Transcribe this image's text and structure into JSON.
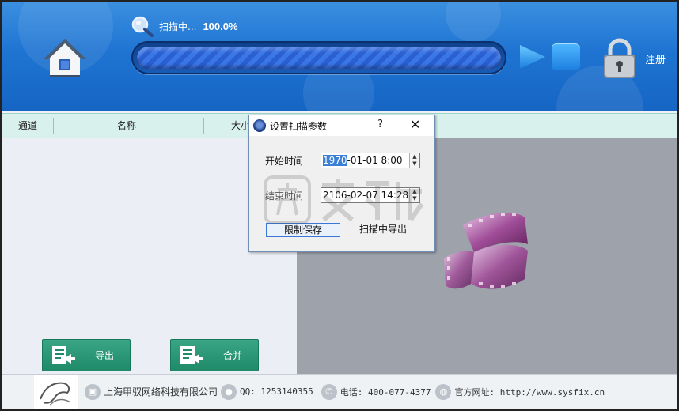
{
  "header": {
    "scan_label": "扫描中...",
    "scan_percent": "100.0%",
    "progress_value": 1.0,
    "register_label": "注册"
  },
  "table": {
    "columns": [
      "通道",
      "名称",
      "大小"
    ]
  },
  "buttons": {
    "export_label": "导出",
    "merge_label": "合并"
  },
  "footer": {
    "company": "上海甲驭网络科技有限公司",
    "qq": "QQ: 1253140355",
    "phone": "电话: 400-077-4377",
    "website": "官方网址: http://www.sysfix.cn"
  },
  "dialog": {
    "title": "设置扫描参数",
    "help": "?",
    "close": "✕",
    "start_label": "开始时间",
    "start_year": "1970",
    "start_rest": "-01-01 8:00",
    "end_label": "结束时间",
    "end_value": "2106-02-07 14:28",
    "limit_save_label": "限制保存",
    "scan_export_label": "扫描中导出"
  },
  "colors": {
    "header_blue": "#1f74d2",
    "table_header": "#d9f1ec",
    "button_green": "#2a9a77"
  }
}
